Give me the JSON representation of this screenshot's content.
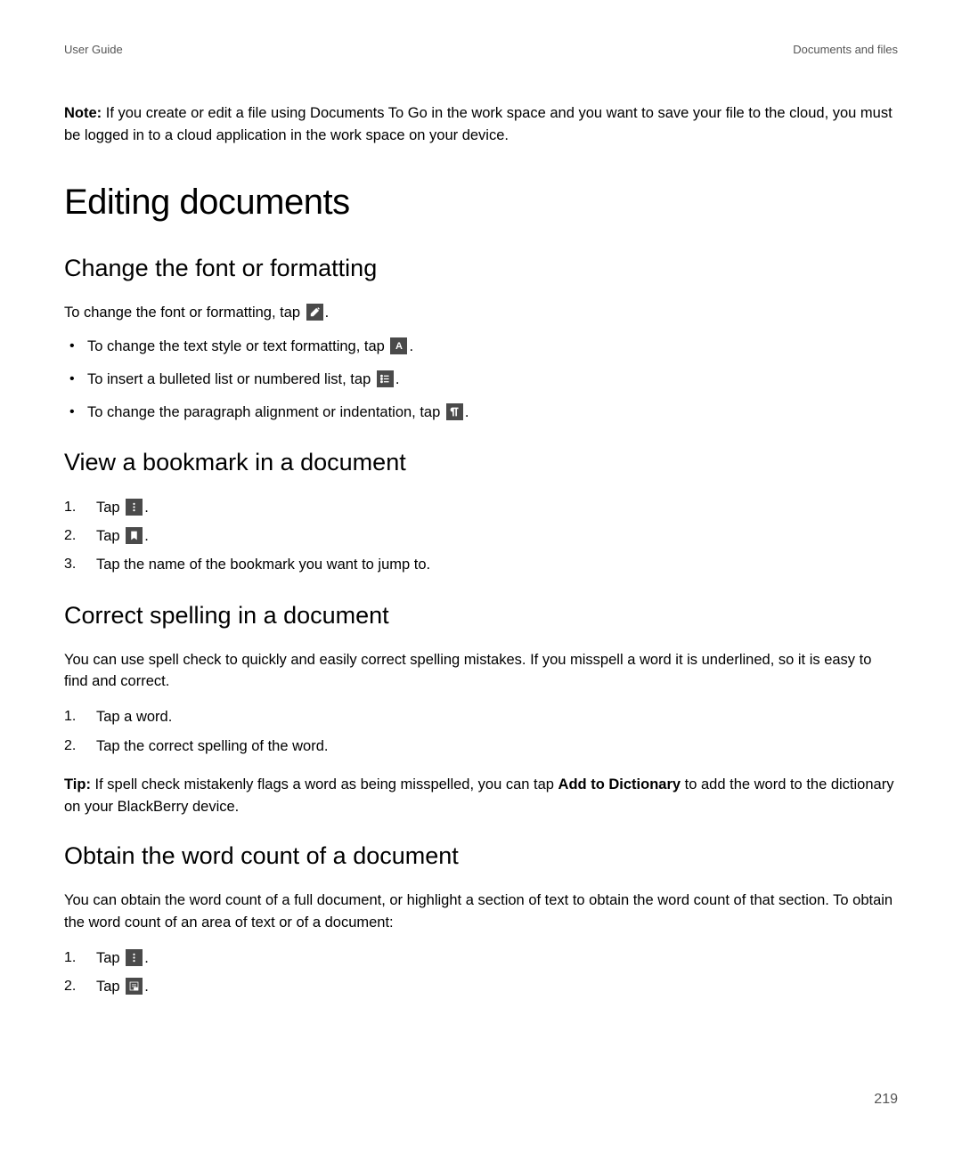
{
  "header": {
    "left": "User Guide",
    "right": "Documents and files"
  },
  "note": {
    "label": "Note:",
    "text": " If you create or edit a file using Documents To Go in the work space and you want to save your file to the cloud, you must be logged in to a cloud application in the work space on your device."
  },
  "h1": "Editing documents",
  "sec1": {
    "title": "Change the font or formatting",
    "intro_before": "To change the font or formatting, tap ",
    "intro_after": ".",
    "b1_before": "To change the text style or text formatting, tap ",
    "b1_after": ".",
    "b2_before": "To insert a bulleted list or numbered list, tap ",
    "b2_after": ".",
    "b3_before": "To change the paragraph alignment or indentation, tap ",
    "b3_after": "."
  },
  "sec2": {
    "title": "View a bookmark in a document",
    "s1_before": "Tap ",
    "s1_after": ".",
    "s2_before": "Tap ",
    "s2_after": ".",
    "s3": "Tap the name of the bookmark you want to jump to."
  },
  "sec3": {
    "title": "Correct spelling in a document",
    "intro": "You can use spell check to quickly and easily correct spelling mistakes. If you misspell a word it is underlined, so it is easy to find and correct.",
    "s1": "Tap a word.",
    "s2": "Tap the correct spelling of the word.",
    "tip_label": "Tip:",
    "tip_before": " If spell check mistakenly flags a word as being misspelled, you can tap ",
    "tip_bold": "Add to Dictionary",
    "tip_after": " to add the word to the dictionary on your BlackBerry device."
  },
  "sec4": {
    "title": "Obtain the word count of a document",
    "intro": "You can obtain the word count of a full document, or highlight a section of text to obtain the word count of that section. To obtain the word count of an area of text or of a document:",
    "s1_before": "Tap ",
    "s1_after": ".",
    "s2_before": "Tap ",
    "s2_after": "."
  },
  "page_number": "219",
  "icons": {
    "pencil_text_a": "A"
  }
}
